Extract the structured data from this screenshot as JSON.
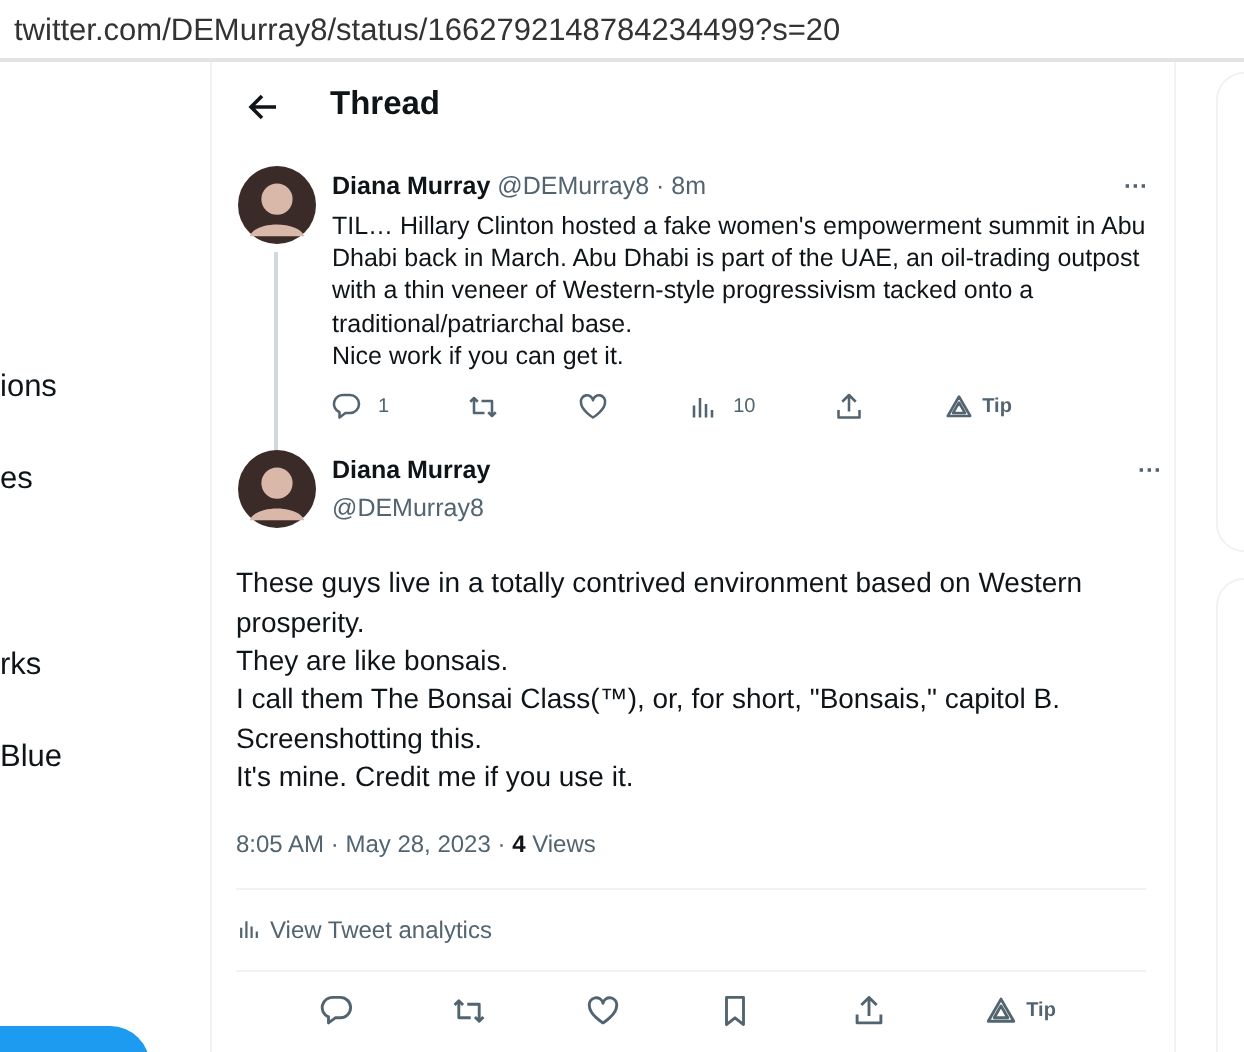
{
  "address_bar": {
    "url": "twitter.com/DEMurray8/status/1662792148784234499?s=20"
  },
  "sidebar": {
    "items": [
      {
        "label": "ions"
      },
      {
        "label": "es"
      },
      {
        "label": "rks"
      },
      {
        "label": "Blue"
      }
    ]
  },
  "header": {
    "title": "Thread"
  },
  "parent_tweet": {
    "name": "Diana Murray",
    "handle": "@DEMurray8",
    "separator": "·",
    "time": "8m",
    "more": "···",
    "paragraphs": [
      "TIL… Hillary Clinton hosted a fake women's empowerment summit in Abu Dhabi back in March. Abu Dhabi is part of the UAE, an oil-trading outpost with a thin veneer of Western-style progressivism tacked onto a traditional/patriarchal base.",
      "Nice work if you can get it."
    ],
    "actions": [
      {
        "kind": "reply",
        "count": "1"
      },
      {
        "kind": "retweet"
      },
      {
        "kind": "like"
      },
      {
        "kind": "views",
        "count": "10"
      },
      {
        "kind": "share"
      },
      {
        "kind": "tip",
        "label": "Tip"
      }
    ]
  },
  "main_tweet": {
    "name": "Diana Murray",
    "handle": "@DEMurray8",
    "more": "···",
    "paragraphs": [
      "These guys live in a totally contrived environment based on Western prosperity.",
      "They are like bonsais.",
      "I call them The Bonsai Class(™), or, for short, \"Bonsais,\" capitol B.",
      "Screenshotting this.",
      "It's mine. Credit me if you use it."
    ],
    "timestamp": "8:05 AM · May 28, 2023 · ",
    "views_count": "4",
    "views_label": "Views",
    "analytics": "View Tweet analytics",
    "actions": [
      {
        "kind": "reply"
      },
      {
        "kind": "retweet"
      },
      {
        "kind": "like"
      },
      {
        "kind": "bookmark"
      },
      {
        "kind": "share"
      },
      {
        "kind": "tip",
        "label": "Tip"
      }
    ]
  }
}
